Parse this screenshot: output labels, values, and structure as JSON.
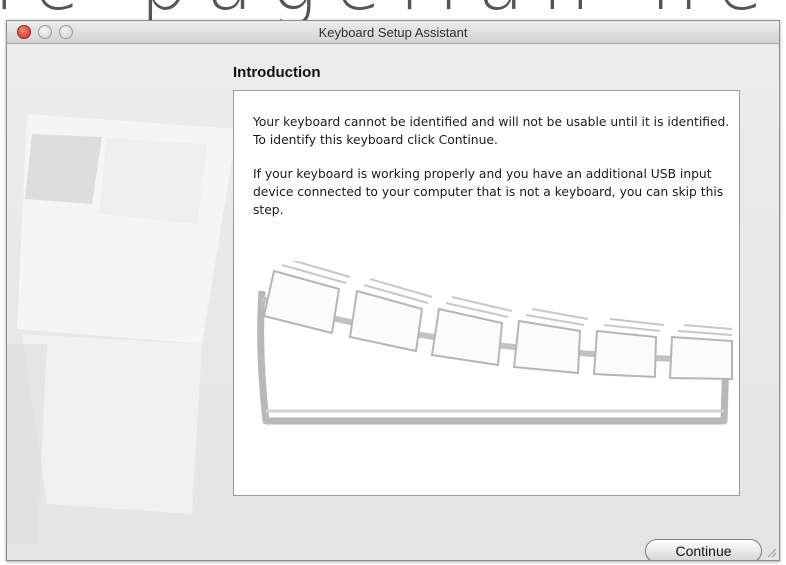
{
  "background_caption_fragment": "ie pagelian new Dreed",
  "window": {
    "title": "Keyboard Setup Assistant"
  },
  "section": {
    "heading": "Introduction"
  },
  "panel": {
    "paragraph1": "Your keyboard cannot be identified and will not be usable until it is identified. To identify this keyboard click Continue.",
    "paragraph2": "If your keyboard is working properly and you have an additional USB input device connected to your computer that is not a keyboard, you can skip this step."
  },
  "buttons": {
    "continue_label": "Continue"
  },
  "icons": {
    "close": "close-button-icon",
    "minimize": "minimize-button-icon",
    "zoom": "zoom-button-icon",
    "watermark": "keyboard-watermark-icon",
    "illustration": "keyboard-keys-illustration"
  },
  "colors": {
    "close_button": "#c72b1f",
    "panel_background": "#ffffff",
    "window_background": "#e8e8e8"
  }
}
